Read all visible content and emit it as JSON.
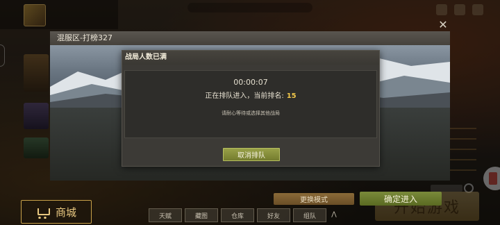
{
  "server_panel": {
    "title": "混服区-打榜327",
    "close_icon": "close-icon"
  },
  "queue_dialog": {
    "title": "战局人数已满",
    "timer": "00:00:07",
    "queue_text": "正在排队进入，当前排名:",
    "rank": "15",
    "hint": "请耐心等待或选择其他战局",
    "cancel_label": "取消排队"
  },
  "bottom": {
    "mall_label": "商城",
    "mall_icon": "cart-icon",
    "start_game_label": "开始游戏",
    "change_mode_label": "更换模式",
    "confirm_enter_label": "确定进入",
    "nav_tabs": [
      "天赋",
      "藏图",
      "仓库",
      "好友",
      "组队"
    ],
    "nav_more": "⋀"
  },
  "colors": {
    "accent_gold": "#f2c84a",
    "button_green": "#98a048",
    "panel_dark": "#3c3a36"
  }
}
